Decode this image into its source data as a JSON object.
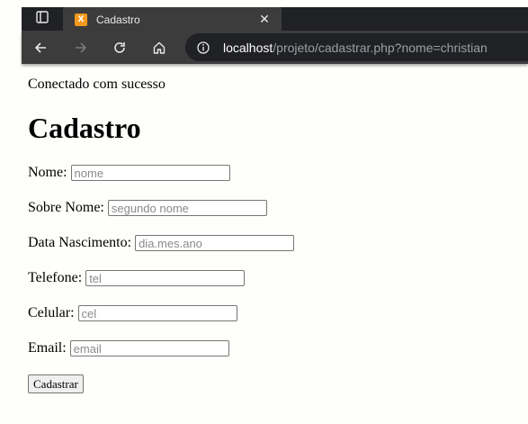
{
  "browser": {
    "tab_title": "Cadastro",
    "tab_close": "✕",
    "favicon_glyph": "X",
    "url_host": "localhost",
    "url_path": "/projeto/cadastrar.php?nome=christian"
  },
  "page": {
    "status": "Conectado com sucesso",
    "heading": "Cadastro",
    "fields": [
      {
        "label": "Nome:",
        "placeholder": "nome",
        "value": ""
      },
      {
        "label": "Sobre Nome:",
        "placeholder": "segundo nome",
        "value": ""
      },
      {
        "label": "Data Nascimento:",
        "placeholder": "dia.mes.ano",
        "value": ""
      },
      {
        "label": "Telefone:",
        "placeholder": "tel",
        "value": ""
      },
      {
        "label": "Celular:",
        "placeholder": "cel",
        "value": ""
      },
      {
        "label": "Email:",
        "placeholder": "email",
        "value": ""
      }
    ],
    "submit_label": "Cadastrar"
  }
}
